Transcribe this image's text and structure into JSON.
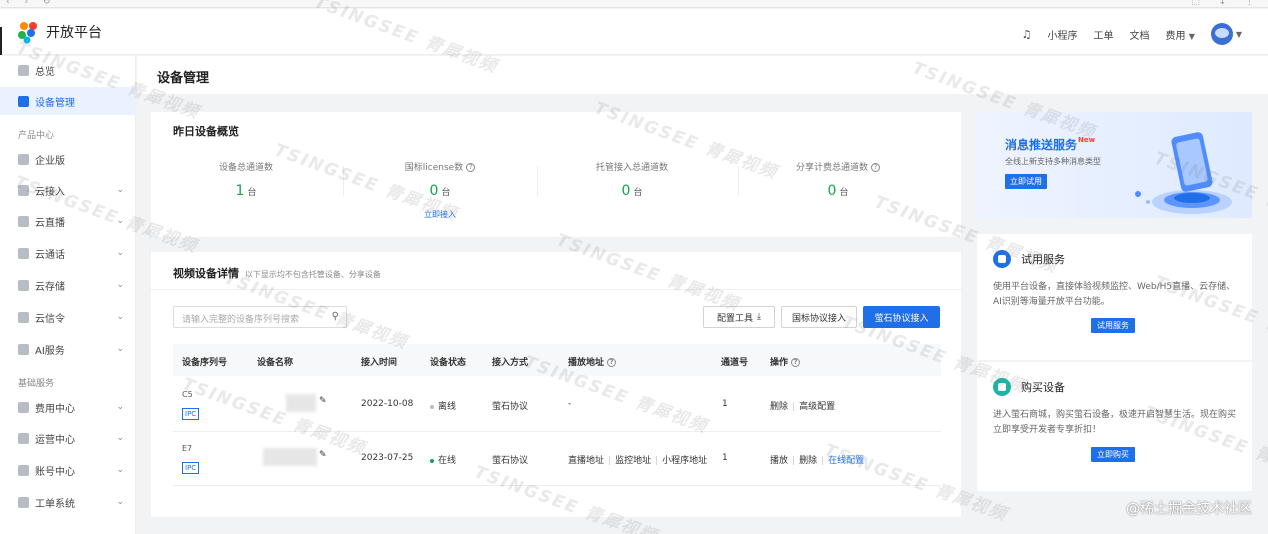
{
  "app": {
    "brand": "开放平台",
    "nav": [
      "小程序",
      "工单",
      "文档",
      "费用"
    ]
  },
  "sidebar": {
    "items": [
      {
        "label": "总览"
      },
      {
        "label": "设备管理"
      },
      {
        "label": "企业版"
      },
      {
        "label": "云接入"
      },
      {
        "label": "云直播"
      },
      {
        "label": "云通话"
      },
      {
        "label": "云存储"
      },
      {
        "label": "云信令"
      },
      {
        "label": "AI服务"
      },
      {
        "label": "费用中心"
      },
      {
        "label": "运营中心"
      },
      {
        "label": "账号中心"
      },
      {
        "label": "工单系统"
      }
    ],
    "section_product": "产品中心",
    "section_basic": "基础服务"
  },
  "page": {
    "title": "设备管理"
  },
  "overview": {
    "title": "昨日设备概览",
    "stats": [
      {
        "label": "设备总通道数",
        "value": "1",
        "unit": "台"
      },
      {
        "label": "国标license数",
        "value": "0",
        "unit": "台"
      },
      {
        "label": "托管接入总通道数",
        "value": "0",
        "unit": "台"
      },
      {
        "label": "分享计费总通道数",
        "value": "0",
        "unit": "台"
      }
    ],
    "link": "立即接入"
  },
  "devices": {
    "title": "视频设备详情",
    "subtitle": "以下显示均不包含托管设备、分享设备",
    "search_placeholder": "请输入完整的设备序列号搜索",
    "buttons": {
      "config_tool": "配置工具",
      "gb_access": "国标协议接入",
      "ez_access": "萤石协议接入"
    },
    "columns": [
      "设备序列号",
      "设备名称",
      "接入时间",
      "设备状态",
      "接入方式",
      "播放地址",
      "通道号",
      "操作"
    ],
    "rows": [
      {
        "serial": "C5",
        "tag": "IPC",
        "time": "2022-10-08",
        "status": "离线",
        "access": "萤石协议",
        "play": "-",
        "channel": "1",
        "ops": [
          "删除",
          "高级配置"
        ]
      },
      {
        "serial": "E7",
        "tag": "IPC",
        "time": "2023-07-25",
        "status": "在线",
        "access": "萤石协议",
        "play_links": [
          "直播地址",
          "监控地址",
          "小程序地址"
        ],
        "channel": "1",
        "ops": [
          "播放",
          "删除",
          "在线配置"
        ]
      }
    ]
  },
  "promo": {
    "title": "消息推送服务",
    "badge": "New",
    "subtitle": "全线上新支持多种消息类型",
    "button": "立即试用"
  },
  "trial": {
    "title": "试用服务",
    "desc": "使用平台设备，直接体验视频监控、Web/H5直播、云存储、AI识别等海量开放平台功能。",
    "button": "试用服务"
  },
  "buy": {
    "title": "购买设备",
    "desc": "进入萤石商城，购买萤石设备，极速开启智慧生活。现在购买立即享受开发者专享折扣！",
    "button": "立即购买"
  },
  "watermark": {
    "text": "TSINGSEE 青犀视频",
    "corner": "@稀土掘金技术社区"
  },
  "colors": {
    "primary": "#1e6fe8",
    "online": "#1aa24a",
    "offline": "#bbbbbb"
  }
}
